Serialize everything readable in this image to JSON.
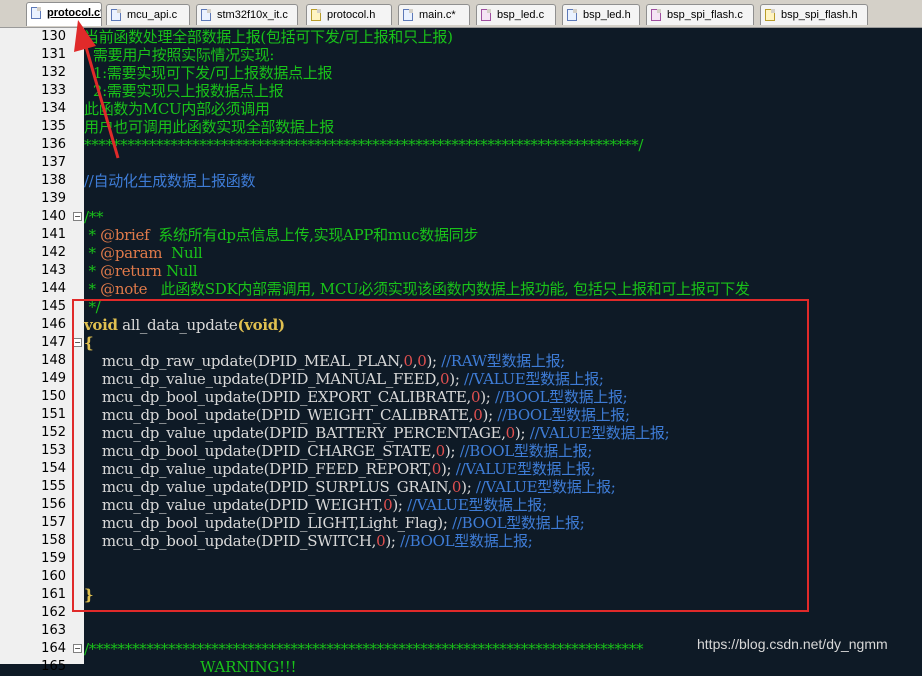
{
  "tabs": [
    {
      "label": "protocol.c*",
      "type": "c",
      "active": true
    },
    {
      "label": "mcu_api.c",
      "type": "c"
    },
    {
      "label": "stm32f10x_it.c",
      "type": "c"
    },
    {
      "label": "protocol.h",
      "type": "h"
    },
    {
      "label": "main.c*",
      "type": "c"
    },
    {
      "label": "bsp_led.c",
      "type": "led"
    },
    {
      "label": "bsp_led.h",
      "type": "c"
    },
    {
      "label": "bsp_spi_flash.c",
      "type": "led"
    },
    {
      "label": "bsp_spi_flash.h",
      "type": "h"
    }
  ],
  "lines": [
    {
      "n": "130",
      "segs": [
        {
          "c": "green",
          "t": "当前函数处理全部数据上报(包括可下发/可上报和只上报)"
        }
      ]
    },
    {
      "n": "131",
      "segs": [
        {
          "c": "green",
          "t": "  需要用户按照实际情况实现:"
        }
      ]
    },
    {
      "n": "132",
      "segs": [
        {
          "c": "green",
          "t": "  1:需要实现可下发/可上报数据点上报"
        }
      ]
    },
    {
      "n": "133",
      "segs": [
        {
          "c": "green",
          "t": "  2:需要实现只上报数据点上报"
        }
      ]
    },
    {
      "n": "134",
      "segs": [
        {
          "c": "green",
          "t": "此函数为MCU内部必须调用"
        }
      ]
    },
    {
      "n": "135",
      "segs": [
        {
          "c": "green",
          "t": "用户也可调用此函数实现全部数据上报"
        }
      ]
    },
    {
      "n": "136",
      "segs": [
        {
          "c": "green",
          "t": "*****************************************************************************/"
        }
      ]
    },
    {
      "n": "137",
      "segs": []
    },
    {
      "n": "138",
      "segs": [
        {
          "c": "comment",
          "t": "//自动化生成数据上报函数"
        }
      ]
    },
    {
      "n": "139",
      "segs": []
    },
    {
      "n": "140",
      "fold": "⊟",
      "segs": [
        {
          "c": "green",
          "t": "/**"
        }
      ]
    },
    {
      "n": "141",
      "segs": [
        {
          "c": "green",
          "t": " * "
        },
        {
          "c": "doctag",
          "t": "@brief"
        },
        {
          "c": "green",
          "t": "  系统所有dp点信息上传,实现APP和muc数据同步"
        }
      ]
    },
    {
      "n": "142",
      "segs": [
        {
          "c": "green",
          "t": " * "
        },
        {
          "c": "doctag",
          "t": "@param"
        },
        {
          "c": "green",
          "t": "  Null"
        }
      ]
    },
    {
      "n": "143",
      "segs": [
        {
          "c": "green",
          "t": " * "
        },
        {
          "c": "doctag",
          "t": "@return"
        },
        {
          "c": "green",
          "t": " Null"
        }
      ]
    },
    {
      "n": "144",
      "segs": [
        {
          "c": "green",
          "t": " * "
        },
        {
          "c": "doctag",
          "t": "@note"
        },
        {
          "c": "green",
          "t": "   此函数SDK内部需调用, MCU必须实现该函数内数据上报功能, 包括只上报和可上报可下发"
        }
      ]
    },
    {
      "n": "145",
      "segs": [
        {
          "c": "green",
          "t": " */"
        }
      ]
    },
    {
      "n": "146",
      "segs": [
        {
          "c": "kw",
          "t": "void"
        },
        {
          "c": "fn",
          "t": " all_data_update"
        },
        {
          "c": "kw",
          "t": "("
        },
        {
          "c": "kw",
          "t": "void"
        },
        {
          "c": "kw",
          "t": ")"
        }
      ]
    },
    {
      "n": "147",
      "fold": "⊟",
      "segs": [
        {
          "c": "kw",
          "t": "{"
        }
      ]
    },
    {
      "n": "148",
      "segs": [
        {
          "c": "fn",
          "t": "    mcu_dp_raw_update(DPID_MEAL_PLAN,"
        },
        {
          "c": "num",
          "t": "0"
        },
        {
          "c": "fn",
          "t": ","
        },
        {
          "c": "num",
          "t": "0"
        },
        {
          "c": "fn",
          "t": "); "
        },
        {
          "c": "comment",
          "t": "//RAW型数据上报;"
        }
      ]
    },
    {
      "n": "149",
      "segs": [
        {
          "c": "fn",
          "t": "    mcu_dp_value_update(DPID_MANUAL_FEED,"
        },
        {
          "c": "num",
          "t": "0"
        },
        {
          "c": "fn",
          "t": "); "
        },
        {
          "c": "comment",
          "t": "//VALUE型数据上报;"
        }
      ]
    },
    {
      "n": "150",
      "segs": [
        {
          "c": "fn",
          "t": "    mcu_dp_bool_update(DPID_EXPORT_CALIBRATE,"
        },
        {
          "c": "num",
          "t": "0"
        },
        {
          "c": "fn",
          "t": "); "
        },
        {
          "c": "comment",
          "t": "//BOOL型数据上报;"
        }
      ]
    },
    {
      "n": "151",
      "segs": [
        {
          "c": "fn",
          "t": "    mcu_dp_bool_update(DPID_WEIGHT_CALIBRATE,"
        },
        {
          "c": "num",
          "t": "0"
        },
        {
          "c": "fn",
          "t": "); "
        },
        {
          "c": "comment",
          "t": "//BOOL型数据上报;"
        }
      ]
    },
    {
      "n": "152",
      "segs": [
        {
          "c": "fn",
          "t": "    mcu_dp_value_update(DPID_BATTERY_PERCENTAGE,"
        },
        {
          "c": "num",
          "t": "0"
        },
        {
          "c": "fn",
          "t": "); "
        },
        {
          "c": "comment",
          "t": "//VALUE型数据上报;"
        }
      ]
    },
    {
      "n": "153",
      "segs": [
        {
          "c": "fn",
          "t": "    mcu_dp_bool_update(DPID_CHARGE_STATE,"
        },
        {
          "c": "num",
          "t": "0"
        },
        {
          "c": "fn",
          "t": "); "
        },
        {
          "c": "comment",
          "t": "//BOOL型数据上报;"
        }
      ]
    },
    {
      "n": "154",
      "segs": [
        {
          "c": "fn",
          "t": "    mcu_dp_value_update(DPID_FEED_REPORT,"
        },
        {
          "c": "num",
          "t": "0"
        },
        {
          "c": "fn",
          "t": "); "
        },
        {
          "c": "comment",
          "t": "//VALUE型数据上报;"
        }
      ]
    },
    {
      "n": "155",
      "segs": [
        {
          "c": "fn",
          "t": "    mcu_dp_value_update(DPID_SURPLUS_GRAIN,"
        },
        {
          "c": "num",
          "t": "0"
        },
        {
          "c": "fn",
          "t": "); "
        },
        {
          "c": "comment",
          "t": "//VALUE型数据上报;"
        }
      ]
    },
    {
      "n": "156",
      "segs": [
        {
          "c": "fn",
          "t": "    mcu_dp_value_update(DPID_WEIGHT,"
        },
        {
          "c": "num",
          "t": "0"
        },
        {
          "c": "fn",
          "t": "); "
        },
        {
          "c": "comment",
          "t": "//VALUE型数据上报;"
        }
      ]
    },
    {
      "n": "157",
      "segs": [
        {
          "c": "fn",
          "t": "    mcu_dp_bool_update(DPID_LIGHT,Light_Flag); "
        },
        {
          "c": "comment",
          "t": "//BOOL型数据上报;"
        }
      ]
    },
    {
      "n": "158",
      "segs": [
        {
          "c": "fn",
          "t": "    mcu_dp_bool_update(DPID_SWITCH,"
        },
        {
          "c": "num",
          "t": "0"
        },
        {
          "c": "fn",
          "t": "); "
        },
        {
          "c": "comment",
          "t": "//BOOL型数据上报;"
        }
      ]
    },
    {
      "n": "159",
      "segs": []
    },
    {
      "n": "160",
      "segs": []
    },
    {
      "n": "161",
      "segs": [
        {
          "c": "kw",
          "t": "}"
        }
      ]
    },
    {
      "n": "162",
      "segs": []
    },
    {
      "n": "163",
      "segs": []
    },
    {
      "n": "164",
      "fold": "⊟",
      "segs": [
        {
          "c": "green",
          "t": "/*****************************************************************************"
        }
      ]
    },
    {
      "n": "165",
      "segs": [
        {
          "c": "green",
          "t": "                          WARNING!!!"
        }
      ]
    }
  ],
  "watermark": "https://blog.csdn.net/dy_ngmm",
  "colors": {
    "highlight_box": "#e02a2a",
    "background": "#0e1a26"
  }
}
